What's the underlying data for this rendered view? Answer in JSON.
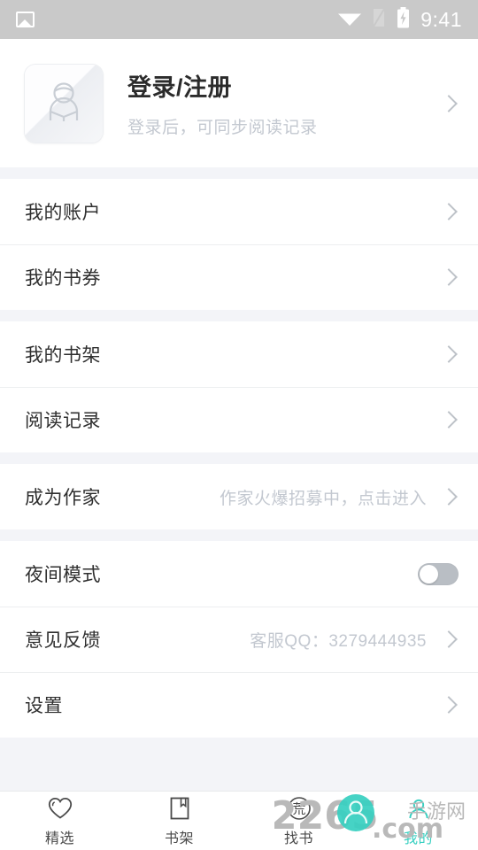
{
  "statusbar": {
    "time": "9:41",
    "icons": [
      "image-icon",
      "wifi-icon",
      "sim-icon",
      "battery-charging-icon"
    ]
  },
  "profile": {
    "title": "登录/注册",
    "subtitle": "登录后，可同步阅读记录",
    "avatar_icon": "person-reading-placeholder-icon"
  },
  "sections": [
    {
      "rows": [
        {
          "label": "我的账户",
          "hint": "",
          "type": "chevron"
        },
        {
          "label": "我的书券",
          "hint": "",
          "type": "chevron"
        }
      ]
    },
    {
      "rows": [
        {
          "label": "我的书架",
          "hint": "",
          "type": "chevron"
        },
        {
          "label": "阅读记录",
          "hint": "",
          "type": "chevron"
        }
      ]
    },
    {
      "rows": [
        {
          "label": "成为作家",
          "hint": "作家火爆招募中，点击进入",
          "type": "chevron"
        }
      ]
    },
    {
      "rows": [
        {
          "label": "夜间模式",
          "hint": "",
          "type": "toggle",
          "toggle_on": false
        },
        {
          "label": "意见反馈",
          "hint": "客服QQ：3279444935",
          "type": "chevron"
        },
        {
          "label": "设置",
          "hint": "",
          "type": "chevron"
        }
      ]
    }
  ],
  "bottom_nav": {
    "items": [
      {
        "label": "精选",
        "icon": "heart-icon",
        "active": false
      },
      {
        "label": "书架",
        "icon": "book-icon",
        "active": false
      },
      {
        "label": "找书",
        "icon": "circle-huang-icon",
        "active": false
      },
      {
        "label": "我的",
        "icon": "person-icon",
        "active": true
      }
    ],
    "active_color": "#36cfc0"
  },
  "watermark": {
    "number": "2265",
    "suffix": ".com",
    "chinese": "手游网"
  },
  "colors": {
    "accent": "#36cfc0",
    "page_bg": "#f3f4f8",
    "card_bg": "#ffffff",
    "status_bar": "#c9c9c9",
    "primary_text": "#2f2f2f",
    "hint_text": "#c3c8d0",
    "toggle_off": "#b9bec4"
  }
}
